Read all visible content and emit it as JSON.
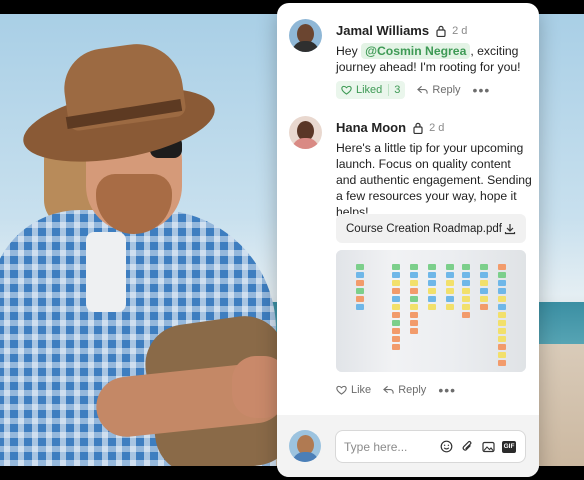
{
  "comments": [
    {
      "author": "Jamal Williams",
      "time": "2 d",
      "text_prefix": "Hey ",
      "mention": "@Cosmin Negrea",
      "text_suffix": ", exciting journey ahead! I'm rooting for you!",
      "like_label": "Liked",
      "like_count": "3",
      "reply_label": "Reply"
    },
    {
      "author": "Hana Moon",
      "time": "2 d",
      "text": "Here's a little tip for your upcoming launch. Focus on quality content and authentic engagement. Sending a few resources your way, hope it helps!",
      "attachment_name": "Course Creation Roadmap.pdf",
      "like_label": "Like",
      "reply_label": "Reply"
    }
  ],
  "composer": {
    "placeholder": "Type here...",
    "gif_label": "GIF"
  },
  "icons": [
    "lock-icon",
    "heart-icon",
    "reply-icon",
    "more-icon",
    "download-icon",
    "emoji-icon",
    "attach-icon",
    "image-icon",
    "gif-icon"
  ],
  "colors": {
    "accent_green": "#3e9a55",
    "like_bg": "#eaf6ec",
    "composer_bg": "#f3f3f3"
  }
}
